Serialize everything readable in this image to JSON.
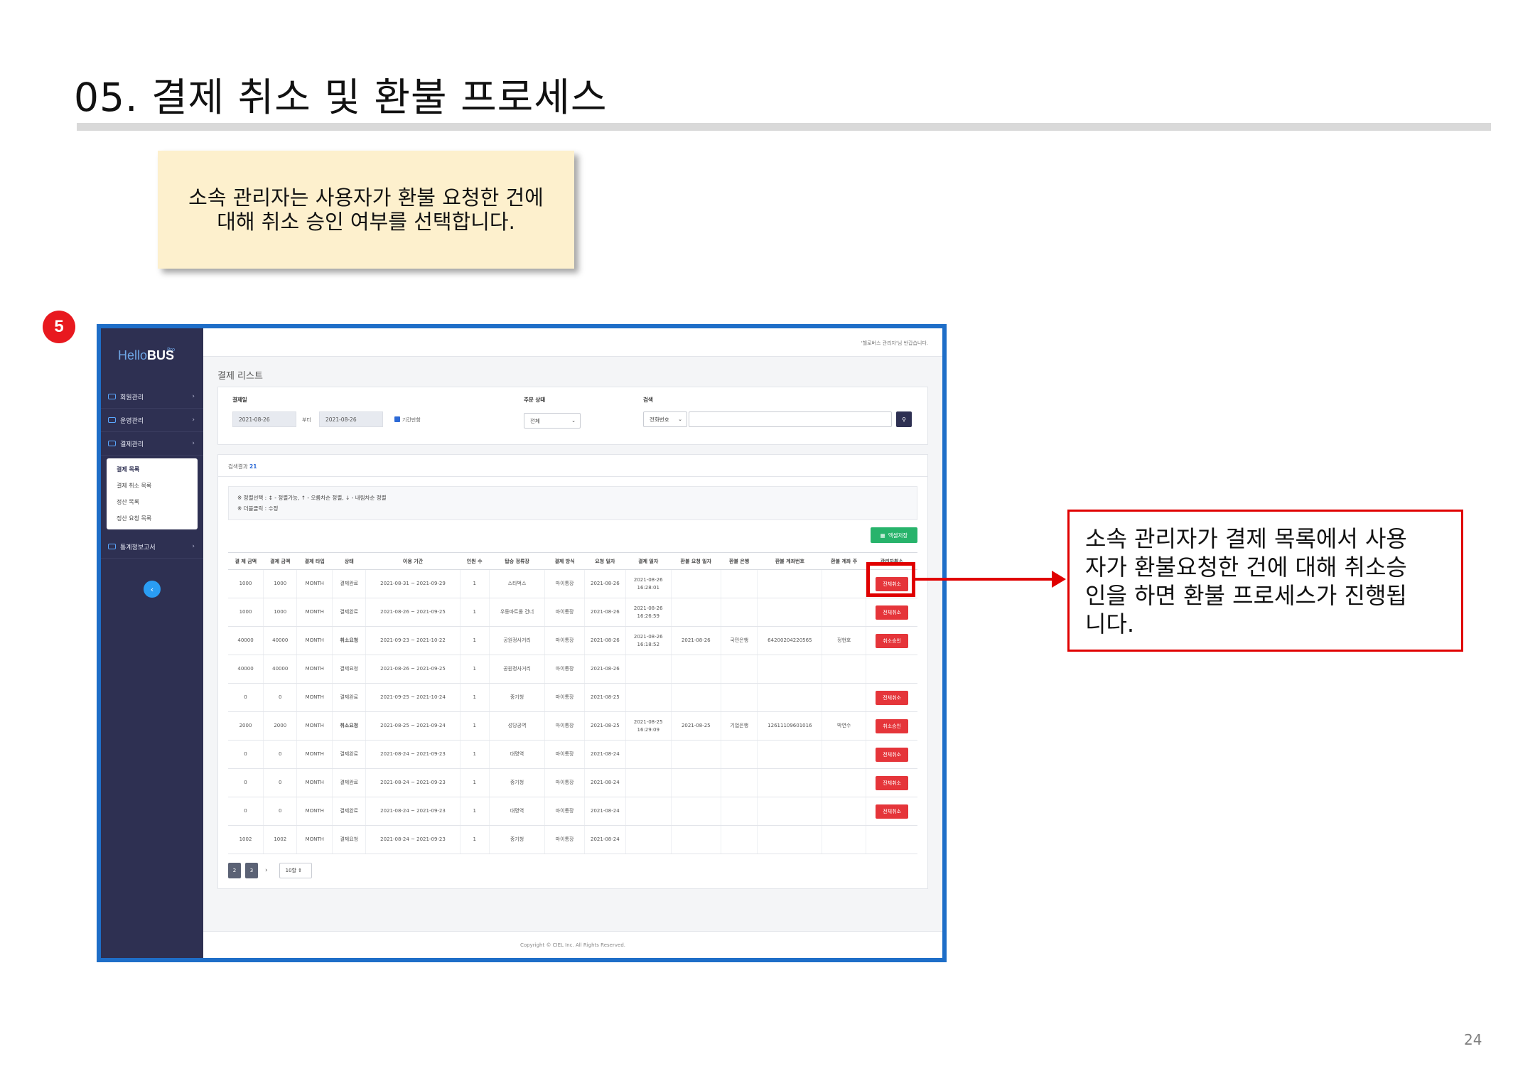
{
  "slide": {
    "title": "05. 결제 취소 및 환불 프로세스",
    "note": "소속 관리자는 사용자가 환불 요청한 건에\n대해 취소  승인 여부를 선택합니다.",
    "step_number": "5",
    "callout": "소속 관리자가 결제 목록에서 사용\n자가 환불요청한 건에 대해 취소승\n인을 하면 환불 프로세스가 진행됩\n니다.",
    "page_number": "24"
  },
  "app": {
    "logo_hello": "Hello",
    "logo_bus": "BUS",
    "logo_tag": "Pro",
    "topbar_user": "'헬로버스 관리자'님 반갑습니다.",
    "sidebar": {
      "items": [
        {
          "label": "회원관리"
        },
        {
          "label": "운영관리"
        },
        {
          "label": "결제관리"
        }
      ],
      "submenu": [
        "결제 목록",
        "결제 취소 목록",
        "정산 목록",
        "정산 요청 목록"
      ],
      "bottom_item": "통계정보고서",
      "circle_icon": "‹"
    },
    "heading": "결제 리스트",
    "filters": {
      "date_label": "결제일",
      "date_from": "2021-08-26",
      "date_sep": "부터",
      "date_to": "2021-08-26",
      "check_label": "기간만함",
      "order_status_label": "주문 상태",
      "order_status_value": "전체",
      "search_label": "검색",
      "search_type": "전화번호",
      "search_value": "",
      "search_icon": "search-icon"
    },
    "list": {
      "result_label": "검색결과",
      "result_count": "21",
      "notes": [
        "※ 정렬선택 : ↕ - 정렬가능, ↑ - 오름차순 정렬, ↓ - 내림차순 정렬",
        "※ 더블클릭 : 수정"
      ],
      "excel_button": "엑셀저장",
      "columns": [
        "결 제 금액",
        "결제 금액",
        "결제 타입",
        "상태",
        "이용 기간",
        "인원 수",
        "탑승 정류장",
        "결제 방식",
        "요청 일자",
        "결제 일자",
        "환불 요청 일자",
        "환불 은행",
        "환불 계좌번호",
        "환불 계좌 주",
        "관리자취소"
      ],
      "rows": [
        {
          "c0": "1000",
          "c1": "1000",
          "c2": "MONTH",
          "c3": "결제완료",
          "c3s": "",
          "c4": "2021-08-31 ~ 2021-09-29",
          "c5": "1",
          "c6": "스타벅스",
          "c7": "마이통장",
          "c8": "2021-08-26",
          "c9": "2021-08-26\n16:28:01",
          "c10": "",
          "c11": "",
          "c12": "",
          "c13": "",
          "act": "전체취소"
        },
        {
          "c0": "1000",
          "c1": "1000",
          "c2": "MONTH",
          "c3": "결제완료",
          "c3s": "",
          "c4": "2021-08-26 ~ 2021-09-25",
          "c5": "1",
          "c6": "우동마트롤 건너",
          "c7": "마이통장",
          "c8": "2021-08-26",
          "c9": "2021-08-26\n16:26:59",
          "c10": "",
          "c11": "",
          "c12": "",
          "c13": "",
          "act": "전체취소"
        },
        {
          "c0": "40000",
          "c1": "40000",
          "c2": "MONTH",
          "c3": "취소요청",
          "c3s": "bold",
          "c4": "2021-09-23 ~ 2021-10-22",
          "c5": "1",
          "c6": "공원정사거리",
          "c7": "마이통장",
          "c8": "2021-08-26",
          "c9": "2021-08-26\n16:18:52",
          "c10": "2021-08-26",
          "c11": "국민은행",
          "c12": "64200204220565",
          "c13": "정현호",
          "act": "취소승인"
        },
        {
          "c0": "40000",
          "c1": "40000",
          "c2": "MONTH",
          "c3": "결제요청",
          "c3s": "warn",
          "c4": "2021-08-26 ~ 2021-09-25",
          "c5": "1",
          "c6": "공원정사거리",
          "c7": "마이통장",
          "c8": "2021-08-26",
          "c9": "",
          "c10": "",
          "c11": "",
          "c12": "",
          "c13": "",
          "act": ""
        },
        {
          "c0": "0",
          "c1": "0",
          "c2": "MONTH",
          "c3": "결제완료",
          "c3s": "",
          "c4": "2021-09-25 ~ 2021-10-24",
          "c5": "1",
          "c6": "중기청",
          "c7": "마이통장",
          "c8": "2021-08-25",
          "c9": "",
          "c10": "",
          "c11": "",
          "c12": "",
          "c13": "",
          "act": "전체취소"
        },
        {
          "c0": "2000",
          "c1": "2000",
          "c2": "MONTH",
          "c3": "취소요청",
          "c3s": "bold",
          "c4": "2021-08-25 ~ 2021-09-24",
          "c5": "1",
          "c6": "성당공역",
          "c7": "마이통장",
          "c8": "2021-08-25",
          "c9": "2021-08-25\n16:29:09",
          "c10": "2021-08-25",
          "c11": "기업은행",
          "c12": "12611109601016",
          "c13": "박연수",
          "act": "취소승인"
        },
        {
          "c0": "0",
          "c1": "0",
          "c2": "MONTH",
          "c3": "결제완료",
          "c3s": "",
          "c4": "2021-08-24 ~ 2021-09-23",
          "c5": "1",
          "c6": "대명역",
          "c7": "마이통장",
          "c8": "2021-08-24",
          "c9": "",
          "c10": "",
          "c11": "",
          "c12": "",
          "c13": "",
          "act": "전체취소"
        },
        {
          "c0": "0",
          "c1": "0",
          "c2": "MONTH",
          "c3": "결제완료",
          "c3s": "",
          "c4": "2021-08-24 ~ 2021-09-23",
          "c5": "1",
          "c6": "중기청",
          "c7": "마이통장",
          "c8": "2021-08-24",
          "c9": "",
          "c10": "",
          "c11": "",
          "c12": "",
          "c13": "",
          "act": "전체취소"
        },
        {
          "c0": "0",
          "c1": "0",
          "c2": "MONTH",
          "c3": "결제완료",
          "c3s": "",
          "c4": "2021-08-24 ~ 2021-09-23",
          "c5": "1",
          "c6": "대명역",
          "c7": "마이통장",
          "c8": "2021-08-24",
          "c9": "",
          "c10": "",
          "c11": "",
          "c12": "",
          "c13": "",
          "act": "전체취소"
        },
        {
          "c0": "1002",
          "c1": "1002",
          "c2": "MONTH",
          "c3": "결제요청",
          "c3s": "warn",
          "c4": "2021-08-24 ~ 2021-09-23",
          "c5": "1",
          "c6": "중기청",
          "c7": "마이통장",
          "c8": "2021-08-24",
          "c9": "",
          "c10": "",
          "c11": "",
          "c12": "",
          "c13": "",
          "act": ""
        }
      ],
      "pager": {
        "pages": [
          "2",
          "3"
        ],
        "next": "›",
        "page_size": "10할 ⇕"
      }
    },
    "footer": "Copyright © CIEL Inc. All Rights Reserved."
  },
  "colors": {
    "frame": "#1e6ec8",
    "sidebar": "#2e3052",
    "callout": "#e00000",
    "action": "#e5353a",
    "excel": "#27b36b",
    "note_bg": "#fdf0cd"
  }
}
